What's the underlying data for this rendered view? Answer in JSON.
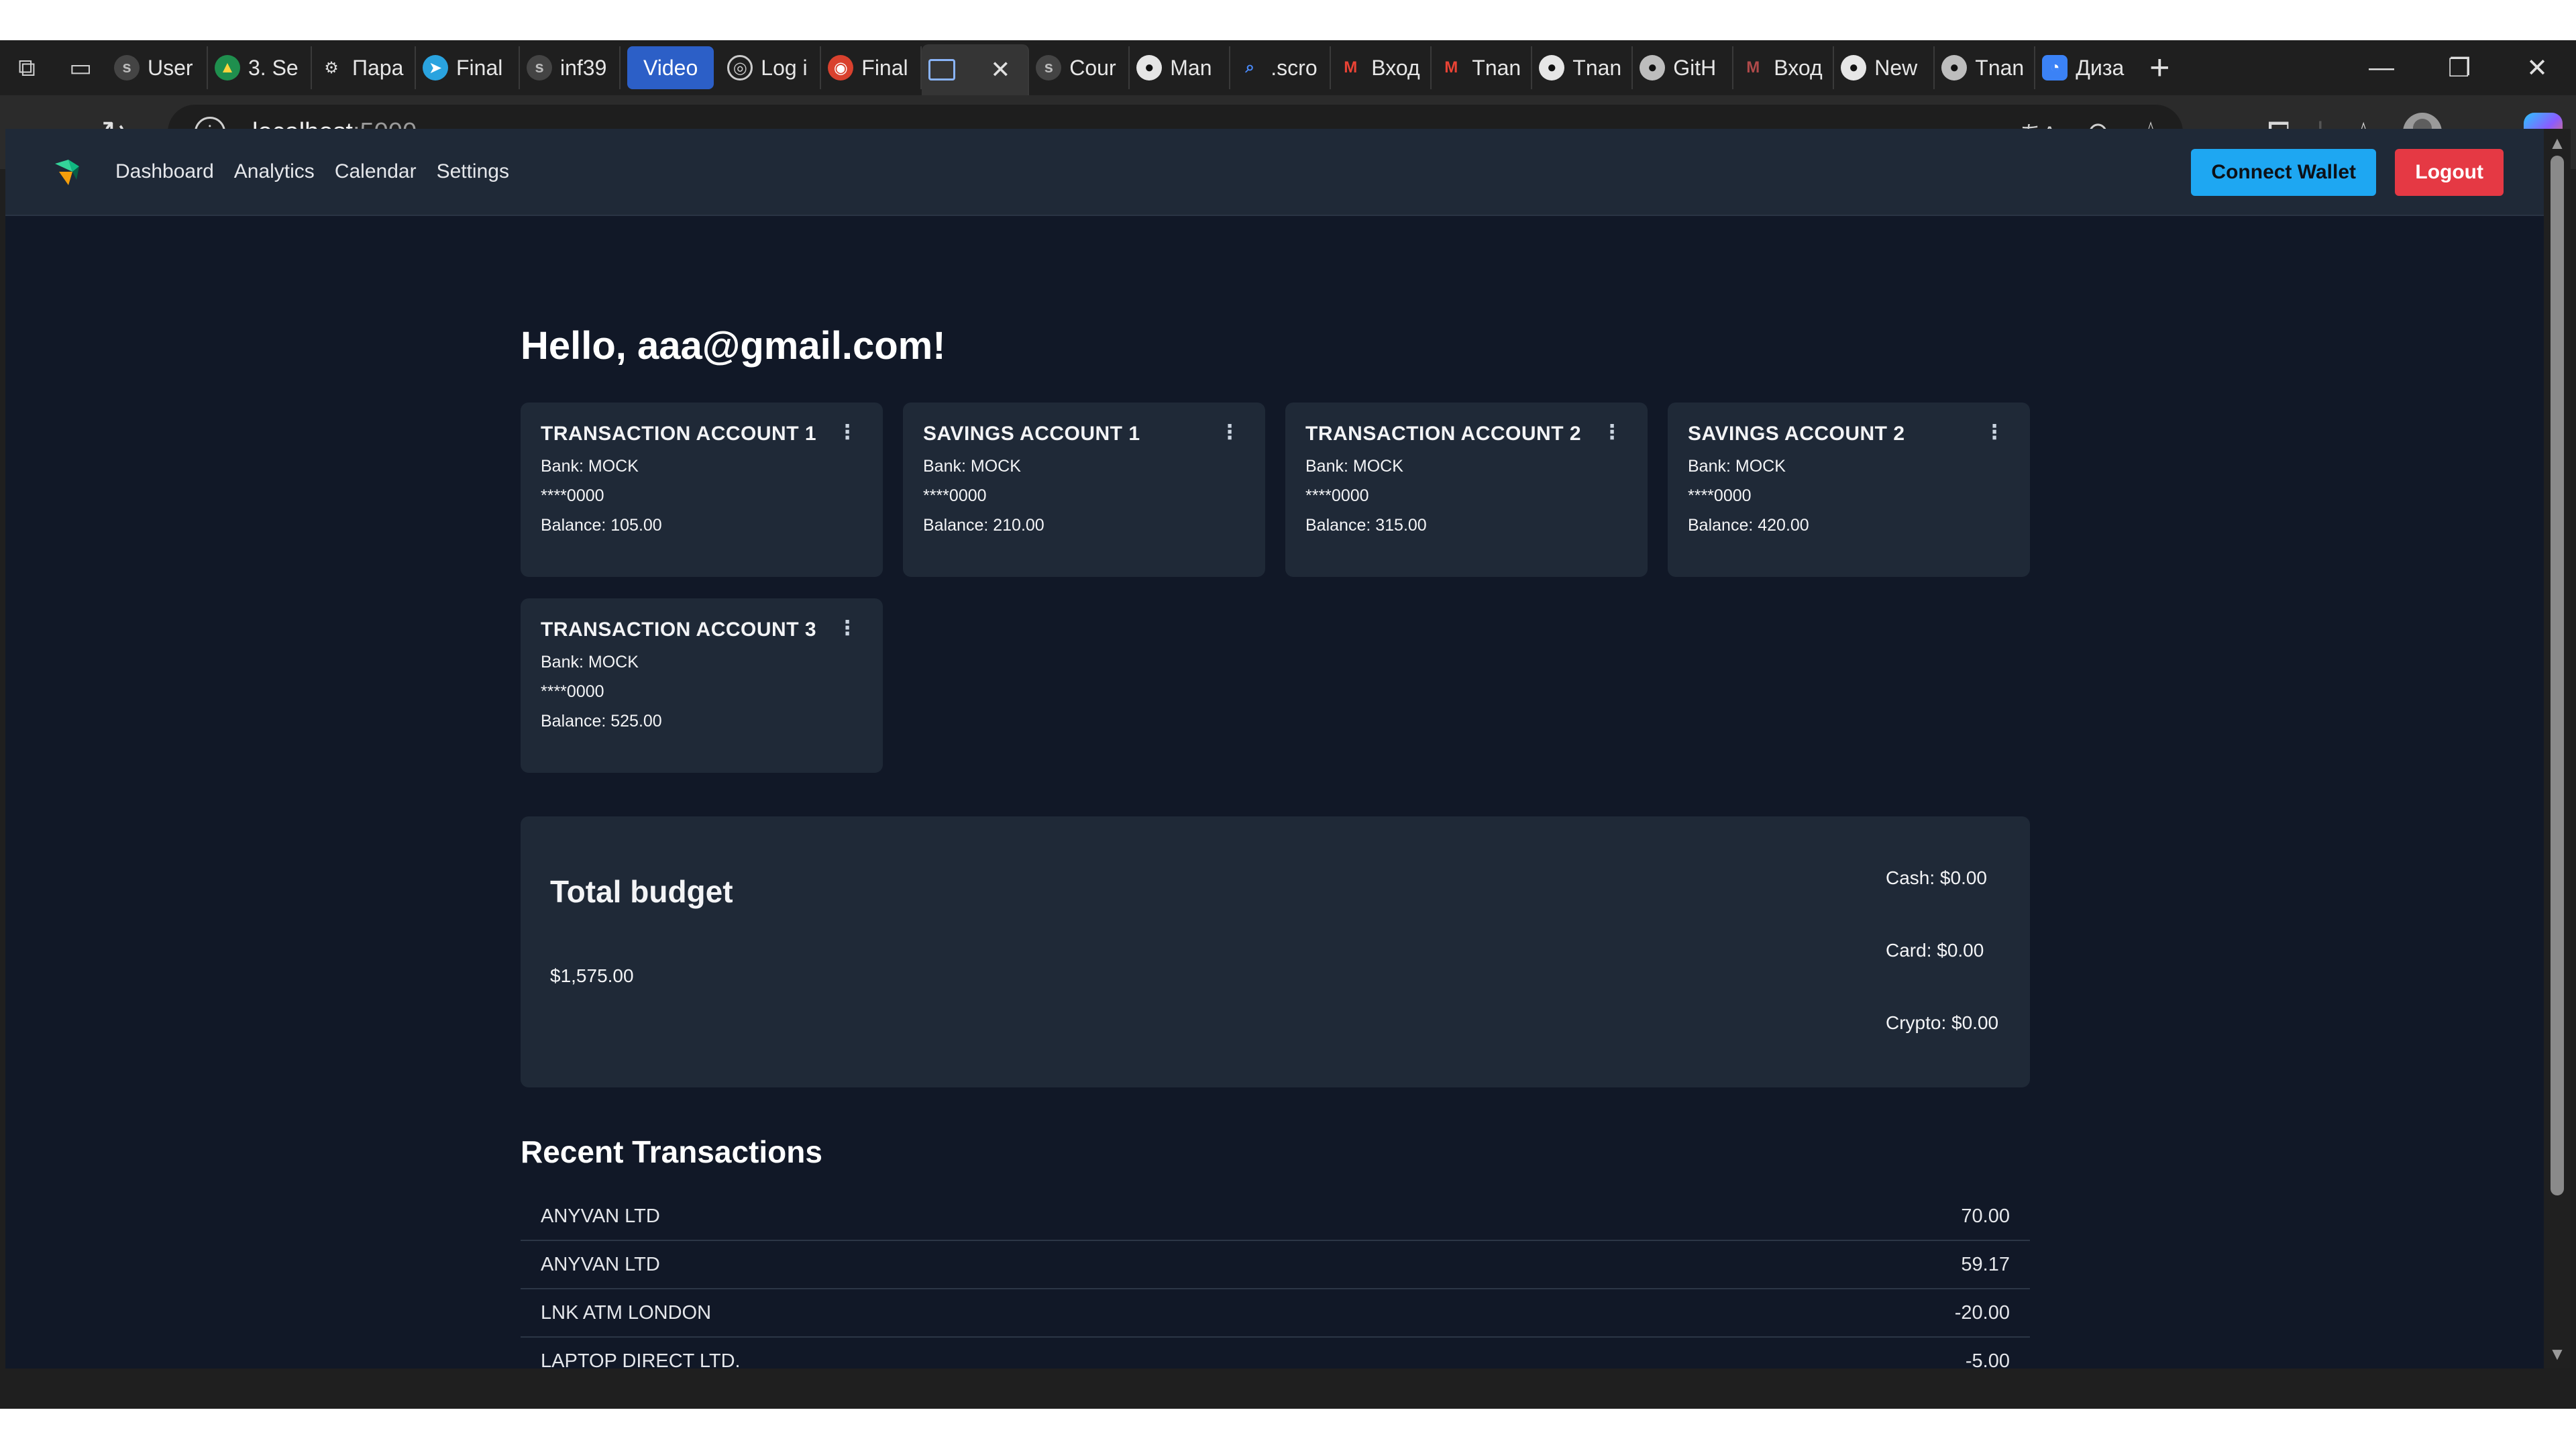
{
  "browser": {
    "tabs": [
      {
        "label": "User",
        "icon": "site-icon"
      },
      {
        "label": "3. Se",
        "icon": "drive-icon"
      },
      {
        "label": "Пара",
        "icon": "gear-icon"
      },
      {
        "label": "Final",
        "icon": "telegram-icon"
      },
      {
        "label": "inf39",
        "icon": "site-icon"
      },
      {
        "label": "Video",
        "icon": "video-tab"
      },
      {
        "label": "Log i",
        "icon": "globe-icon"
      },
      {
        "label": "Final",
        "icon": "app-icon"
      }
    ],
    "active_tab_icon": "terminal-icon",
    "tabs_after": [
      {
        "label": "Cour",
        "icon": "site-icon"
      },
      {
        "label": "Man",
        "icon": "github-icon"
      },
      {
        "label": ".scro",
        "icon": "search-icon"
      },
      {
        "label": "Вход",
        "icon": "gmail-icon"
      },
      {
        "label": "Tnan",
        "icon": "gmail-icon"
      },
      {
        "label": "Tnan",
        "icon": "github-icon"
      },
      {
        "label": "GitH",
        "icon": "github-icon"
      },
      {
        "label": "Вход",
        "icon": "gmail-icon"
      },
      {
        "label": "New",
        "icon": "github-icon"
      },
      {
        "label": "Tnan",
        "icon": "github-icon"
      },
      {
        "label": "Диза",
        "icon": "copilot-icon"
      }
    ],
    "url_host": "localhost",
    "url_port": ":5000"
  },
  "nav": {
    "links": [
      "Dashboard",
      "Analytics",
      "Calendar",
      "Settings"
    ],
    "connect_wallet": "Connect Wallet",
    "logout": "Logout"
  },
  "greeting": "Hello, aaa@gmail.com!",
  "accounts": [
    {
      "name": "TRANSACTION ACCOUNT 1",
      "bank": "Bank: MOCK",
      "number": "****0000",
      "balance": "Balance: 105.00"
    },
    {
      "name": "SAVINGS ACCOUNT 1",
      "bank": "Bank: MOCK",
      "number": "****0000",
      "balance": "Balance: 210.00"
    },
    {
      "name": "TRANSACTION ACCOUNT 2",
      "bank": "Bank: MOCK",
      "number": "****0000",
      "balance": "Balance: 315.00"
    },
    {
      "name": "SAVINGS ACCOUNT 2",
      "bank": "Bank: MOCK",
      "number": "****0000",
      "balance": "Balance: 420.00"
    },
    {
      "name": "TRANSACTION ACCOUNT 3",
      "bank": "Bank: MOCK",
      "number": "****0000",
      "balance": "Balance: 525.00"
    }
  ],
  "budget": {
    "title": "Total budget",
    "total": "$1,575.00",
    "cash": "Cash: $0.00",
    "card": "Card: $0.00",
    "crypto": "Crypto: $0.00"
  },
  "transactions": {
    "title": "Recent Transactions",
    "rows": [
      {
        "name": "ANYVAN LTD",
        "amount": "70.00"
      },
      {
        "name": "ANYVAN LTD",
        "amount": "59.17"
      },
      {
        "name": "LNK ATM LONDON",
        "amount": "-20.00"
      },
      {
        "name": "LAPTOP DIRECT LTD.",
        "amount": "-5.00"
      }
    ]
  },
  "colors": {
    "page_bg": "#111827",
    "card_bg": "#1f2937",
    "connect_wallet": "#1ea7f2",
    "logout": "#e53944"
  }
}
